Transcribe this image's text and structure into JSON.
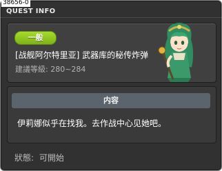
{
  "window": {
    "quest_id": "38656-0",
    "title": "QUEST INFO"
  },
  "quest": {
    "category": "一般",
    "name": "[战舰阿尔特里亚] 武器库的秘传炸弹",
    "level_range": "建議等級: 280~284"
  },
  "content": {
    "header": "内容",
    "text": "伊莉娜似乎在找我。去作战中心见她吧。"
  },
  "status": {
    "label": "狀態:",
    "value": "可開始"
  },
  "colors": {
    "window_bg": "#313131",
    "badge_green": "#8cc51f",
    "header_bg": "#5b646c"
  },
  "icons": {
    "portrait": "npc-portrait-green-hair"
  }
}
